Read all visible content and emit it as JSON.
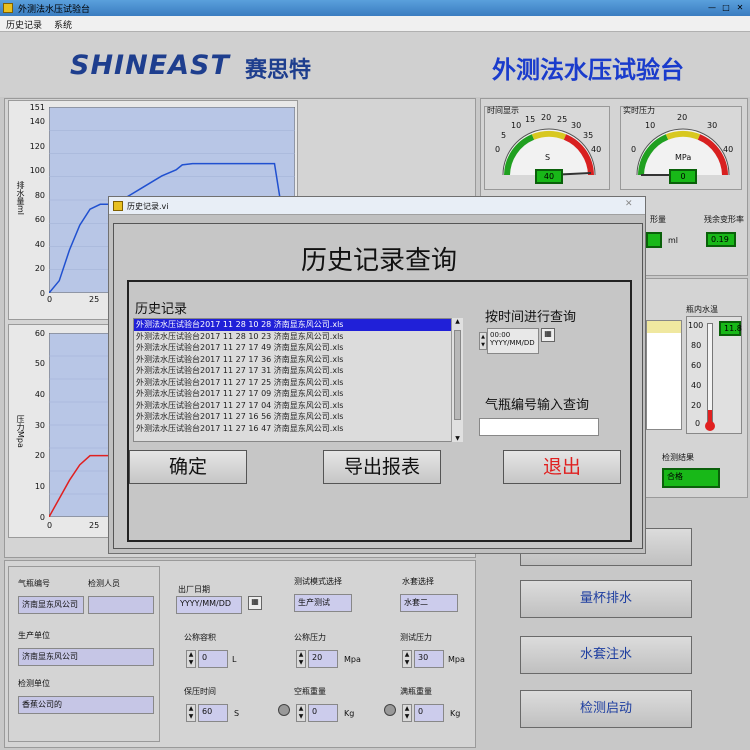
{
  "window": {
    "title": "外测法水压试验台"
  },
  "menu": [
    "历史记录",
    "系统"
  ],
  "header": {
    "logo": "SHINEAST",
    "logo_cn": "赛思特",
    "title": "外测法水压试验台"
  },
  "chart_top": {
    "ylabel": "排水量ml",
    "yticks": [
      "151",
      "140",
      "120",
      "100",
      "80",
      "60",
      "40",
      "20",
      "0"
    ],
    "xticks": [
      "0",
      "25"
    ]
  },
  "chart_bottom": {
    "ylabel": "压力Mpa",
    "yticks": [
      "60",
      "50",
      "40",
      "30",
      "20",
      "10",
      "0"
    ],
    "xticks": [
      "0",
      "25"
    ]
  },
  "chart_data": [
    {
      "type": "line",
      "ylabel": "排水量ml",
      "ylim": [
        0,
        151
      ],
      "x": [
        0,
        5,
        10,
        15,
        20,
        25,
        30,
        35,
        40,
        45,
        55,
        62,
        65,
        70,
        75,
        80,
        90,
        100,
        110,
        120
      ],
      "values": [
        0,
        10,
        35,
        55,
        68,
        72,
        72,
        75,
        80,
        85,
        95,
        100,
        104,
        105,
        105,
        105,
        105,
        105,
        105,
        0
      ],
      "xticks": [
        "0",
        "25"
      ],
      "yticks": [
        "0",
        "20",
        "40",
        "60",
        "80",
        "100",
        "120",
        "140",
        "151"
      ]
    },
    {
      "type": "line",
      "ylabel": "压力Mpa",
      "ylim": [
        0,
        60
      ],
      "x": [
        0,
        5,
        10,
        15,
        20,
        25,
        30
      ],
      "values": [
        0,
        6,
        12,
        17,
        20,
        20,
        20
      ],
      "xticks": [
        "0",
        "25"
      ],
      "yticks": [
        "0",
        "10",
        "20",
        "30",
        "40",
        "50",
        "60"
      ]
    }
  ],
  "gauges": [
    {
      "label": "时间显示",
      "unit": "S",
      "value": "40",
      "ticks": [
        "0",
        "5",
        "10",
        "15",
        "20",
        "25",
        "30",
        "35",
        "40"
      ]
    },
    {
      "label": "实时压力",
      "unit": "MPa",
      "value": "0",
      "ticks": [
        "0",
        "10",
        "20",
        "30",
        "40"
      ]
    }
  ],
  "right_fields": {
    "partial1": "形量",
    "ml": "ml",
    "perm_label": "残余变形率",
    "perm_value": "0.19",
    "water_temp_label": "瓶内水温",
    "temp_ticks": [
      "100",
      "80",
      "60",
      "40",
      "20",
      "0"
    ],
    "temp_value": "11.8",
    "result_label": "检测结果",
    "result_value": "合格"
  },
  "dialog": {
    "title": "历史记录.vi",
    "heading": "历史记录查询",
    "list_label": "历史记录",
    "items": [
      "外测法水压试验台2017 11 28 10 28 济南显东风公司.xls",
      "外测法水压试验台2017 11 28 10 23 济南显东风公司.xls",
      "外测法水压试验台2017 11 27 17 49 济南显东风公司.xls",
      "外测法水压试验台2017 11 27 17 36 济南显东风公司.xls",
      "外测法水压试验台2017 11 27 17 31 济南显东风公司.xls",
      "外测法水压试验台2017 11 27 17 25 济南显东风公司.xls",
      "外测法水压试验台2017 11 27 17 09 济南显东风公司.xls",
      "外测法水压试验台2017 11 27 17 04 济南显东风公司.xls",
      "外测法水压试验台2017 11 27 16 56 济南显东风公司.xls",
      "外测法水压试验台2017 11 27 16 47 济南显东风公司.xls"
    ],
    "time_label": "按时间进行查询",
    "time_value": "00:00",
    "date_value": "YYYY/MM/DD",
    "bottle_label": "气瓶编号输入查询",
    "bottle_value": "",
    "ok": "确定",
    "export": "导出报表",
    "exit": "退出"
  },
  "form": {
    "bottle_no_label": "气瓶编号",
    "inspector_label": "检测人员",
    "bottle_no": "济南显东风公司",
    "inspector": "",
    "producer_label": "生产单位",
    "producer": "济南显东风公司",
    "inspect_unit_label": "检测单位",
    "inspect_unit": "香蕉公司的",
    "mfg_date_label": "出厂日期",
    "mfg_date": "YYYY/MM/DD",
    "mode_label": "测试模式选择",
    "mode": "生产测试",
    "jacket_label": "水套选择",
    "jacket": "水套二",
    "vol_label": "公称容积",
    "vol": "0",
    "vol_unit": "L",
    "press_label": "公称压力",
    "press": "20",
    "press_unit": "Mpa",
    "test_press_label": "测试压力",
    "test_press": "30",
    "test_press_unit": "Mpa",
    "hold_label": "保压时间",
    "hold": "60",
    "hold_unit": "S",
    "empty_wt_label": "空瓶重量",
    "empty_wt": "0",
    "empty_wt_unit": "Kg",
    "full_wt_label": "满瓶重量",
    "full_wt": "0",
    "full_wt_unit": "Kg"
  },
  "buttons": {
    "cup": "量杯排水",
    "jacket_fill": "水套注水",
    "start": "检测启动"
  },
  "colors": {
    "plot_bg": "#b8c6e6",
    "line1": "#2050d0",
    "line2": "#e02020",
    "accent": "#1a3ccc"
  }
}
